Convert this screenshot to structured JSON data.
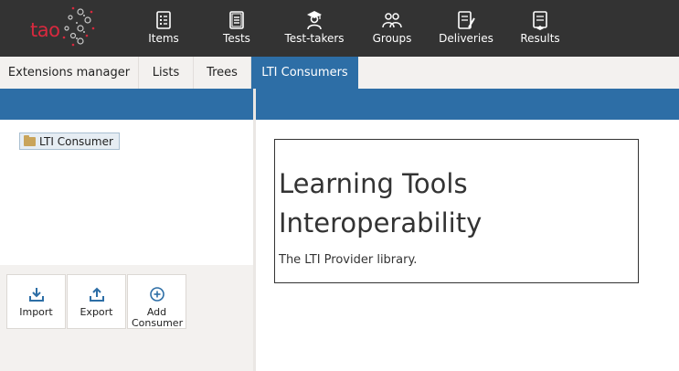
{
  "brand": {
    "logo_text": "tao"
  },
  "nav": {
    "items": [
      {
        "label": "Items",
        "icon": "items-icon"
      },
      {
        "label": "Tests",
        "icon": "tests-icon"
      },
      {
        "label": "Test-takers",
        "icon": "test-takers-icon"
      },
      {
        "label": "Groups",
        "icon": "groups-icon"
      },
      {
        "label": "Deliveries",
        "icon": "deliveries-icon"
      },
      {
        "label": "Results",
        "icon": "results-icon"
      }
    ]
  },
  "tabs": [
    {
      "label": "Extensions manager",
      "active": false
    },
    {
      "label": "Lists",
      "active": false
    },
    {
      "label": "Trees",
      "active": false
    },
    {
      "label": "LTI Consumers",
      "active": true
    }
  ],
  "tree": {
    "root_label": "LTI Consumer"
  },
  "actions": [
    {
      "label": "Import",
      "icon": "import-icon"
    },
    {
      "label": "Export",
      "icon": "export-icon"
    },
    {
      "label": "Add Consumer",
      "icon": "add-icon"
    }
  ],
  "content": {
    "title": "Learning Tools Interoperability",
    "description": "The LTI Provider library."
  },
  "colors": {
    "topbar": "#333333",
    "accent": "#2d6ea6",
    "brand_red": "#d8293e",
    "panel_bg": "#f3f1ef"
  }
}
